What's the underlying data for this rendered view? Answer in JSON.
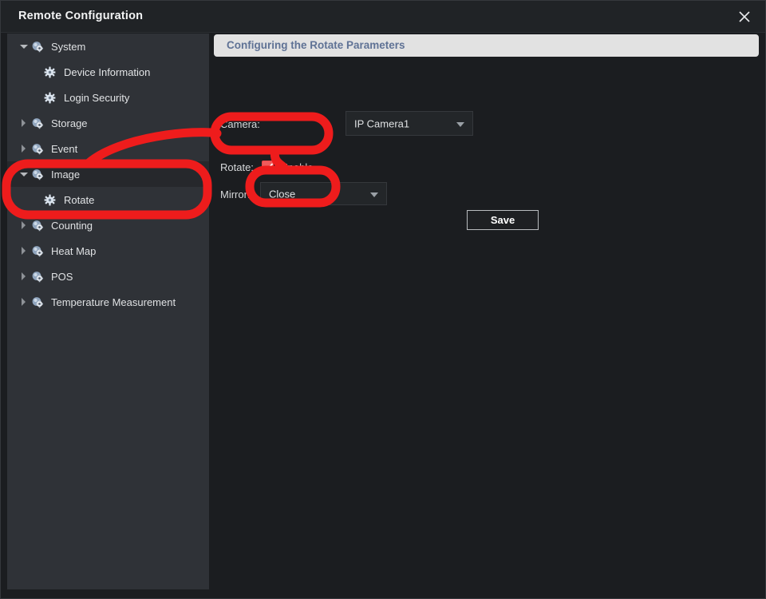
{
  "window": {
    "title": "Remote Configuration",
    "close_icon": "close-icon"
  },
  "sidebar": {
    "items": [
      {
        "label": "System",
        "level": 0,
        "state": "open",
        "icon": "gear-sphere-icon",
        "selected": false
      },
      {
        "label": "Device Information",
        "level": 1,
        "state": "none",
        "icon": "gear-icon",
        "selected": false
      },
      {
        "label": "Login Security",
        "level": 1,
        "state": "none",
        "icon": "gear-icon",
        "selected": false
      },
      {
        "label": "Storage",
        "level": 0,
        "state": "closed",
        "icon": "gear-sphere-icon",
        "selected": false
      },
      {
        "label": "Event",
        "level": 0,
        "state": "closed",
        "icon": "gear-sphere-icon",
        "selected": false
      },
      {
        "label": "Image",
        "level": 0,
        "state": "open",
        "icon": "gear-sphere-icon",
        "selected": true
      },
      {
        "label": "Rotate",
        "level": 1,
        "state": "none",
        "icon": "gear-icon",
        "selected": false
      },
      {
        "label": "Counting",
        "level": 0,
        "state": "closed",
        "icon": "gear-sphere-icon",
        "selected": false
      },
      {
        "label": "Heat Map",
        "level": 0,
        "state": "closed",
        "icon": "gear-sphere-icon",
        "selected": false
      },
      {
        "label": "POS",
        "level": 0,
        "state": "closed",
        "icon": "gear-sphere-icon",
        "selected": false
      },
      {
        "label": "Temperature Measurement",
        "level": 0,
        "state": "closed",
        "icon": "gear-sphere-icon",
        "selected": false
      }
    ]
  },
  "main": {
    "banner_title": "Configuring the Rotate Parameters",
    "camera": {
      "label": "Camera:",
      "value": "IP Camera1",
      "options": [
        "IP Camera1"
      ]
    },
    "rotate": {
      "label": "Rotate:",
      "enable_caption": "Enable",
      "checked": true
    },
    "mirror": {
      "label": "Mirror:",
      "value": "Close",
      "options": [
        "Close"
      ]
    },
    "save_label": "Save"
  },
  "colors": {
    "annotation_red": "#ee1c1c",
    "banner_bg": "#e2e2e2",
    "banner_text": "#5f7295",
    "checkbox_fill": "#f05b5b",
    "sidebar_bg": "#2f3237",
    "panel_bg": "#1b1d20"
  }
}
